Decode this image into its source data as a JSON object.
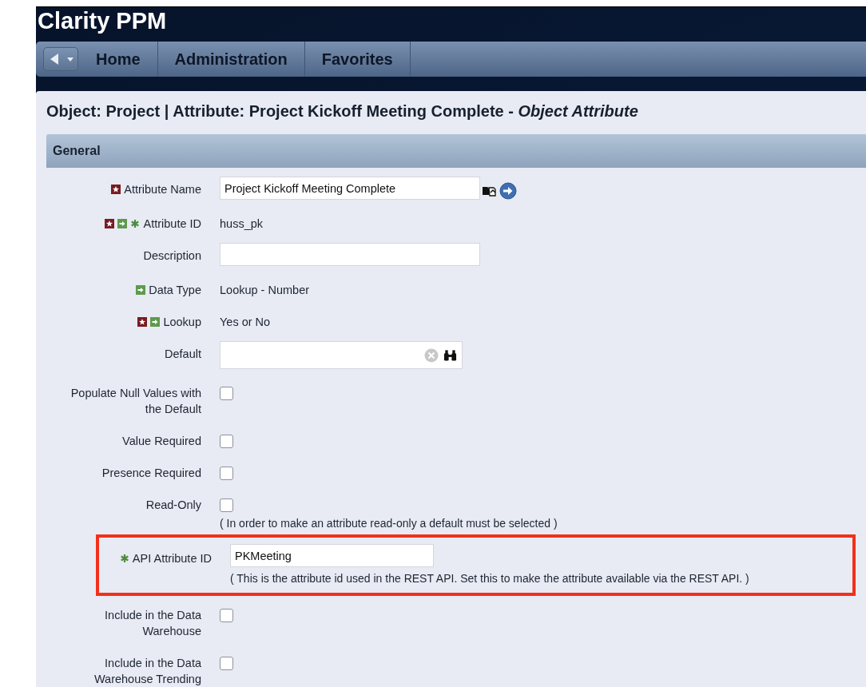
{
  "app_title": "Clarity PPM",
  "menu": [
    "Home",
    "Administration",
    "Favorites"
  ],
  "page_title": "Object: Project | Attribute: Project Kickoff Meeting Complete - *Object Attribute*",
  "section": "General",
  "fields": [
    {
      "label": "Attribute Name",
      "required": true,
      "locked": false,
      "api": false,
      "kind": "translate_input",
      "value": "Project Kickoff Meeting Complete",
      "highlighted": false
    },
    {
      "label": "Attribute ID",
      "required": true,
      "locked": true,
      "api": true,
      "kind": "static",
      "value": "huss_pk",
      "highlighted": false
    },
    {
      "label": "Description",
      "required": false,
      "locked": false,
      "api": false,
      "kind": "input",
      "highlighted": false
    },
    {
      "label": "Data Type",
      "required": false,
      "locked": true,
      "api": false,
      "kind": "static",
      "value": "Lookup - Number",
      "highlighted": false
    },
    {
      "label": "Lookup",
      "required": true,
      "locked": true,
      "api": false,
      "kind": "static",
      "value": "Yes or No",
      "highlighted": false
    },
    {
      "label": "Default",
      "required": false,
      "locked": false,
      "api": false,
      "kind": "browse_input",
      "highlighted": false
    },
    {
      "label": "Populate Null Values with the Default",
      "required": false,
      "locked": false,
      "api": false,
      "kind": "checkbox",
      "checked": false,
      "highlighted": false
    },
    {
      "label": "Value Required",
      "required": false,
      "locked": false,
      "api": false,
      "kind": "checkbox",
      "checked": false,
      "highlighted": false
    },
    {
      "label": "Presence Required",
      "required": false,
      "locked": false,
      "api": false,
      "kind": "checkbox",
      "checked": false,
      "highlighted": false
    },
    {
      "label": "Read-Only",
      "required": false,
      "locked": false,
      "api": false,
      "kind": "checkbox",
      "checked": false,
      "note": "( In order to make an attribute read-only a default must be selected )",
      "highlighted": false
    },
    {
      "label": "API Attribute ID",
      "required": false,
      "locked": false,
      "api": true,
      "kind": "input",
      "value": "PKMeeting",
      "note": "( This is the attribute id used in the REST API. Set this to make the attribute available via the REST API. )",
      "highlighted": true
    },
    {
      "label": "Include in the Data Warehouse",
      "required": false,
      "locked": false,
      "api": false,
      "kind": "checkbox",
      "checked": false,
      "highlighted": false
    },
    {
      "label": "Include in the Data Warehouse Trending",
      "required": false,
      "locked": false,
      "api": false,
      "kind": "checkbox",
      "checked": false,
      "highlighted": false
    }
  ]
}
